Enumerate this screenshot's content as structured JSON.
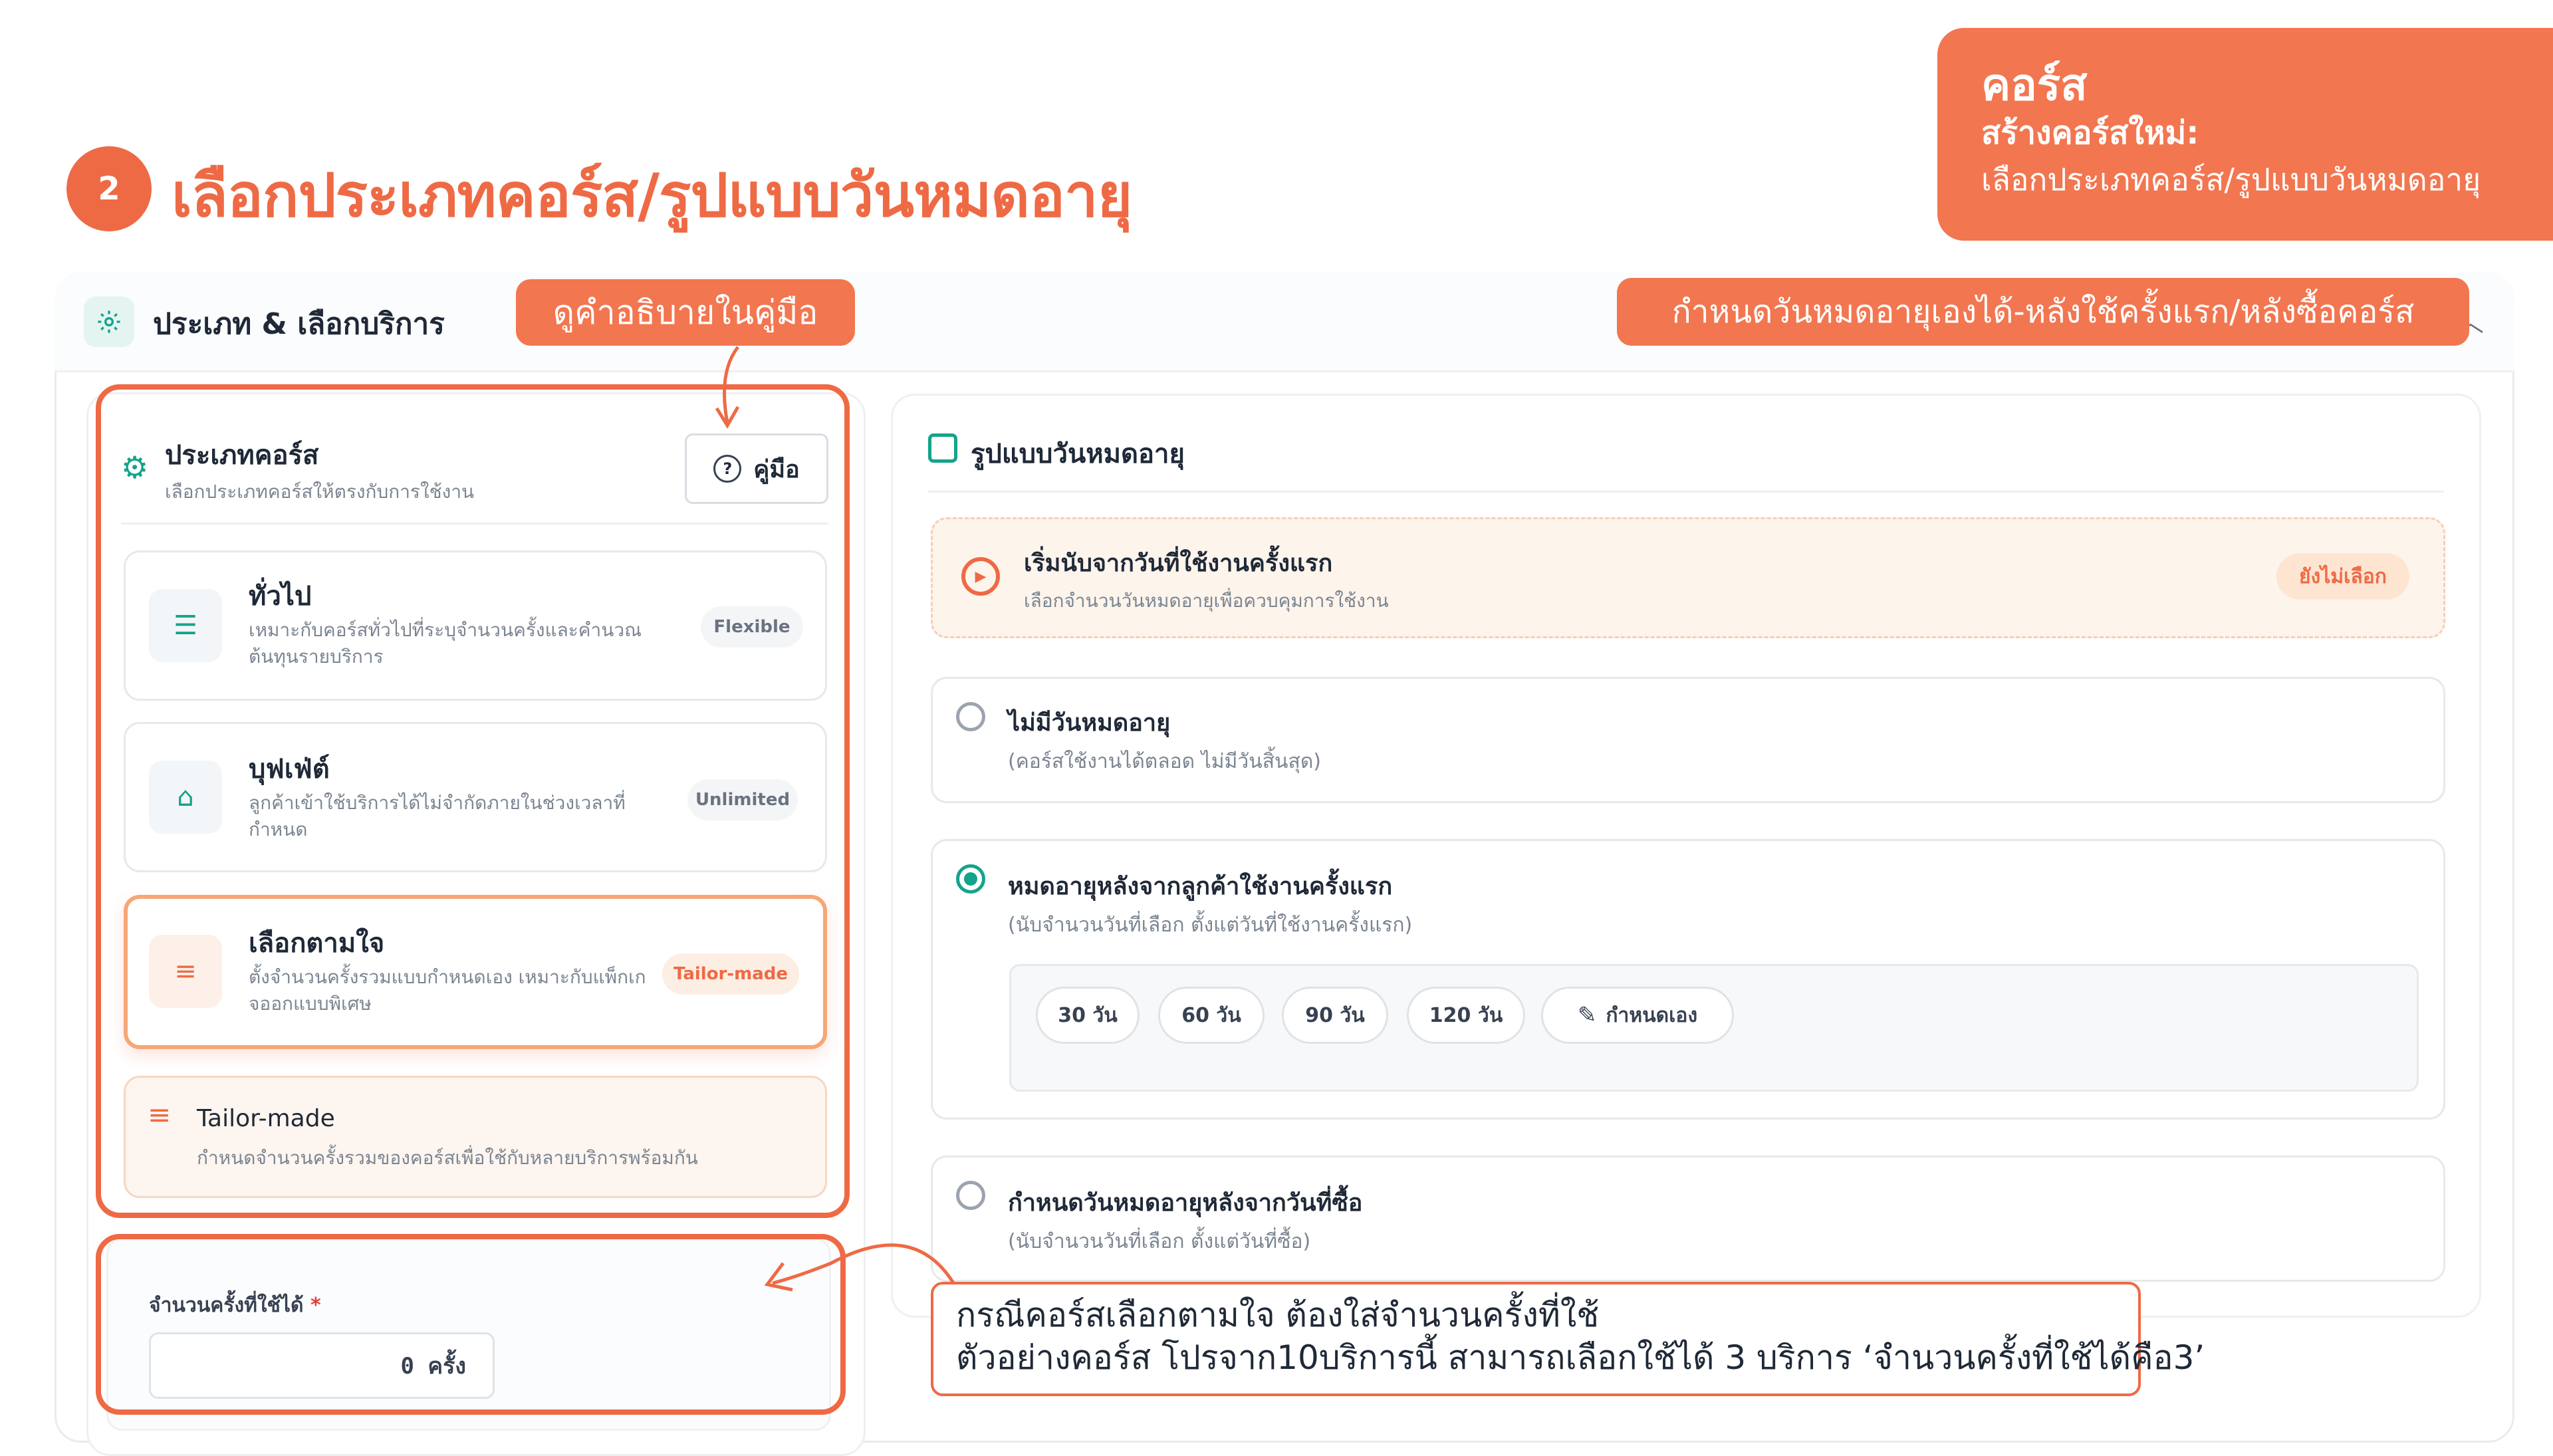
{
  "header": {
    "step_number": "2",
    "title": "เลือกประเภทคอร์ส/รูปแบบวันหมดอายุ"
  },
  "banner": {
    "section": "คอร์ส",
    "subtitle": "สร้างคอร์สใหม่:",
    "description": "เลือกประเภทคอร์ส/รูปแบบวันหมดอายุ"
  },
  "frame": {
    "title": "ประเภท & เลือกบริการ"
  },
  "callouts": {
    "guide_hint": "ดูคำอธิบายในคู่มือ",
    "expiry_hint": "กำหนดวันหมดอายุเองได้-หลังใช้ครั้งแรก/หลังซื้อคอร์ส",
    "note_line1": "กรณีคอร์สเลือกตามใจ ต้องใส่จำนวนครั้งที่ใช้",
    "note_line2": "ตัวอย่างคอร์ส โปรจาก10บริการนี้ สามารถเลือกใช้ได้ 3 บริการ ‘จำนวนครั้งที่ใช้ได้คือ3’"
  },
  "course_type": {
    "title": "ประเภทคอร์ส",
    "subtitle": "เลือกประเภทคอร์สให้ตรงกับการใช้งาน",
    "guide_button": "คู่มือ",
    "options": [
      {
        "title": "ทั่วไป",
        "desc": "เหมาะกับคอร์สทั่วไปที่ระบุจำนวนครั้งและคำนวณต้นทุนรายบริการ",
        "badge": "Flexible",
        "icon": "list-icon",
        "selected": false
      },
      {
        "title": "บุฟเฟ่ต์",
        "desc": "ลูกค้าเข้าใช้บริการได้ไม่จำกัดภายในช่วงเวลาที่กำหนด",
        "badge": "Unlimited",
        "icon": "building-icon",
        "selected": false
      },
      {
        "title": "เลือกตามใจ",
        "desc": "ตั้งจำนวนครั้งรวมแบบกำหนดเอง เหมาะกับแพ็กเกจออกแบบพิเศษ",
        "badge": "Tailor-made",
        "icon": "sliders-icon",
        "selected": true
      }
    ],
    "tailor_title": "Tailor-made",
    "tailor_desc": "กำหนดจำนวนครั้งรวมของคอร์สเพื่อใช้กับหลายบริการพร้อมกัน",
    "count_label": "จำนวนครั้งที่ใช้ได้",
    "count_required": "*",
    "count_value": "0 ครั้ง"
  },
  "expiry": {
    "title": "รูปแบบวันหมดอายุ",
    "status_title": "เริ่มนับจากวันที่ใช้งานครั้งแรก",
    "status_desc": "เลือกจำนวนวันหมดอายุเพื่อควบคุมการใช้งาน",
    "status_badge": "ยังไม่เลือก",
    "options": [
      {
        "title": "ไม่มีวันหมดอายุ",
        "desc": "(คอร์สใช้งานได้ตลอด ไม่มีวันสิ้นสุด)",
        "selected": false
      },
      {
        "title": "หมดอายุหลังจากลูกค้าใช้งานครั้งแรก",
        "desc": "(นับจำนวนวันที่เลือก ตั้งแต่วันที่ใช้งานครั้งแรก)",
        "selected": true
      },
      {
        "title": "กำหนดวันหมดอายุหลังจากวันที่ซื้อ",
        "desc": "(นับจำนวนวันที่เลือก ตั้งแต่วันที่ซื้อ)",
        "selected": false
      }
    ],
    "chips": [
      "30 วัน",
      "60 วัน",
      "90 วัน",
      "120 วัน"
    ],
    "custom_chip": "กำหนดเอง"
  },
  "colors": {
    "accent": "#ee6a45",
    "teal": "#14a38b"
  }
}
